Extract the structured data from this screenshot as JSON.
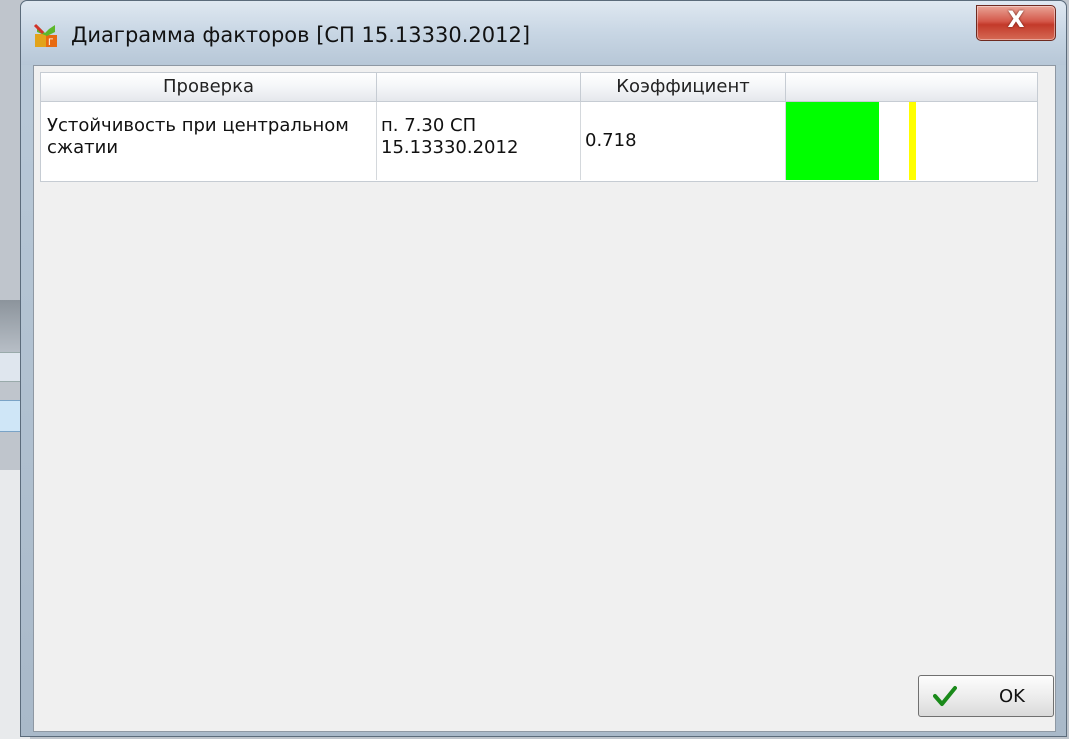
{
  "window": {
    "title": "Диаграмма факторов [СП 15.13330.2012]",
    "close_label": "X"
  },
  "table": {
    "columns": [
      "Проверка",
      "",
      "Коэффициент",
      ""
    ],
    "rows": [
      {
        "check": "Устойчивость при центральном сжатии",
        "reference": "п. 7.30 СП 15.13330.2012",
        "coefficient": "0.718",
        "factor_fraction": 0.718,
        "bar_color": "#00ff00",
        "limit_fraction": 1.0,
        "limit_color": "#ffff00"
      }
    ]
  },
  "buttons": {
    "ok_label": "OK"
  },
  "colors": {
    "check_icon": "#1a8a1a"
  }
}
